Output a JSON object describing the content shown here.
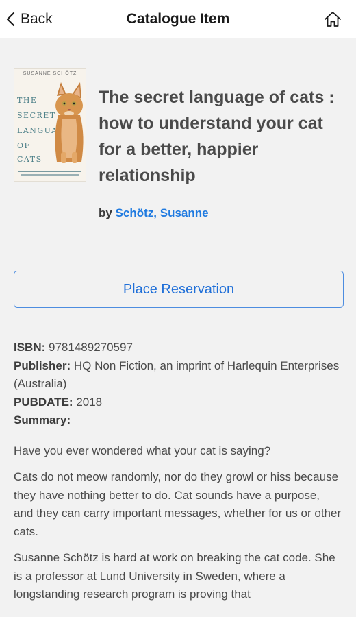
{
  "nav": {
    "back_label": "Back",
    "title": "Catalogue Item"
  },
  "book": {
    "cover_author": "SUSANNE SCHÖTZ",
    "cover_title_lines": [
      "THE",
      "SECRET",
      "LANGUAGE",
      "OF",
      "CATS"
    ],
    "title": "The secret language of cats : how to understand your cat for a better, happier relationship",
    "by_label": "by",
    "author": "Schötz, Susanne"
  },
  "actions": {
    "reserve_label": "Place Reservation"
  },
  "details": {
    "isbn_label": "ISBN:",
    "isbn": "9781489270597",
    "publisher_label": "Publisher:",
    "publisher": "HQ Non Fiction, an imprint of Harlequin Enterprises (Australia)",
    "pubdate_label": "PUBDATE:",
    "pubdate": "2018",
    "summary_label": "Summary:",
    "summary": [
      "Have you ever wondered what your cat is saying?",
      "Cats do not meow randomly, nor do they growl or hiss because they have nothing better to do. Cat sounds have a purpose, and they can carry important messages, whether for us or other cats.",
      "Susanne Schötz is hard at work on breaking the cat code. She is a professor at Lund University in Sweden, where a longstanding research program is proving that"
    ]
  }
}
